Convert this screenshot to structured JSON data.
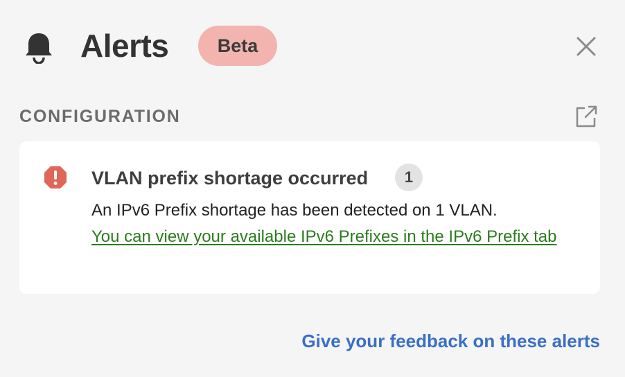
{
  "header": {
    "title": "Alerts",
    "badge": "Beta",
    "icons": {
      "bell": "bell-icon",
      "close": "close-icon"
    }
  },
  "section": {
    "title": "CONFIGURATION",
    "icon": "external-link-icon"
  },
  "alert": {
    "icon": "warning-octagon-icon",
    "title": "VLAN prefix shortage occurred",
    "count": "1",
    "description": "An IPv6 Prefix shortage has been detected on 1 VLAN.",
    "link_text": "You can view your available IPv6 Prefixes in the IPv6 Prefix tab"
  },
  "footer": {
    "feedback_link": "Give your feedback on these alerts"
  },
  "colors": {
    "background": "#f5f5f5",
    "badge": "#f3b4b0",
    "warning": "#e0665a",
    "link_green": "#2a7c1d",
    "link_blue": "#3a6fc7"
  }
}
